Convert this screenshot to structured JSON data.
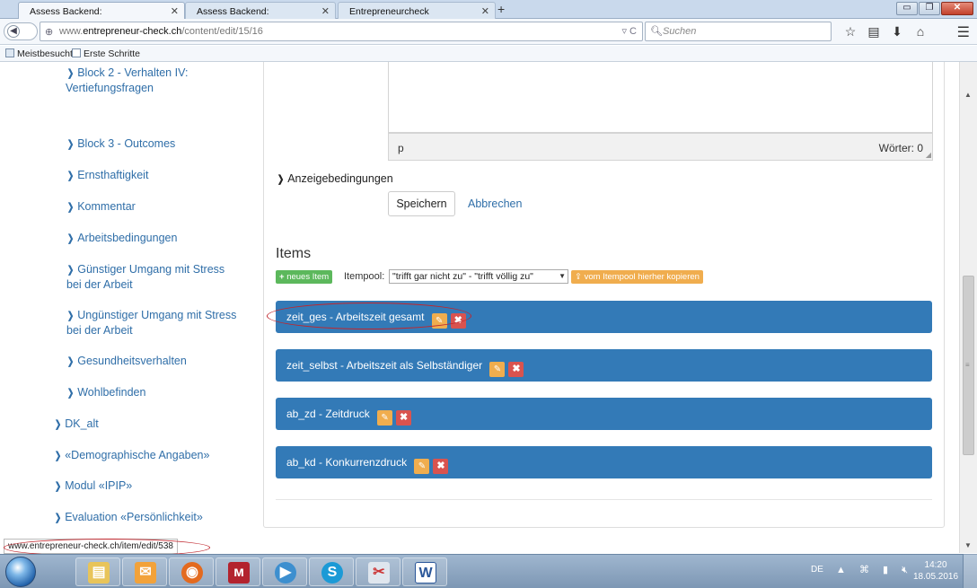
{
  "browser": {
    "tabs": [
      {
        "title": "Assess Backend:",
        "active": true
      },
      {
        "title": "Assess Backend:",
        "active": false
      },
      {
        "title": "Entrepreneurcheck",
        "active": false
      }
    ],
    "url_prefix": "www.",
    "url_domain": "entrepreneur-check.ch",
    "url_path": "/content/edit/15/16",
    "search_placeholder": "Suchen",
    "bookmarks": [
      "Meistbesucht",
      "Erste Schritte"
    ]
  },
  "sidebar": {
    "items": [
      {
        "label": "Block 2 - Verhalten IV:",
        "label2": "Vertiefungsfragen"
      },
      {
        "label": "Block 3 - Outcomes"
      },
      {
        "label": "Ernsthaftigkeit"
      },
      {
        "label": "Kommentar"
      },
      {
        "label": "Arbeitsbedingungen"
      },
      {
        "label": "Günstiger Umgang mit Stress",
        "label2": "bei der Arbeit"
      },
      {
        "label": "Ungünstiger Umgang mit Stress",
        "label2": "bei der Arbeit"
      },
      {
        "label": "Gesundheitsverhalten"
      },
      {
        "label": "Wohlbefinden"
      },
      {
        "label": "DK_alt"
      },
      {
        "label": "«Demographische Angaben»"
      },
      {
        "label": "Modul «IPIP»"
      },
      {
        "label": "Evaluation «Persönlichkeit»"
      }
    ]
  },
  "editor": {
    "path": "p",
    "word_count": "Wörter: 0"
  },
  "form": {
    "display_conditions": "Anzeigebedingungen",
    "save_label": "Speichern",
    "cancel_label": "Abbrechen"
  },
  "items": {
    "title": "Items",
    "new_item_label": "neues Item",
    "itempool_label": "Itempool:",
    "itempool_value": "\"trifft gar nicht zu\" - \"trifft völlig zu\"",
    "copy_label": "vom Itempool hierher kopieren",
    "rows": [
      {
        "label": "zeit_ges - Arbeitszeit gesamt"
      },
      {
        "label": "zeit_selbst - Arbeitszeit als Selbständiger"
      },
      {
        "label": "ab_zd - Zeitdruck"
      },
      {
        "label": "ab_kd - Konkurrenzdruck"
      }
    ]
  },
  "status_url": "www.entrepreneur-check.ch/item/edit/538",
  "taskbar": {
    "language": "DE",
    "time": "14:20",
    "date": "18.05.2016"
  },
  "colors": {
    "item_blue": "#337ab7",
    "edit_orange": "#f0ad4e",
    "delete_red": "#d9534f",
    "new_green": "#5cb85c",
    "link_blue": "#2f6ea8",
    "annotation_red": "#c0262d"
  }
}
